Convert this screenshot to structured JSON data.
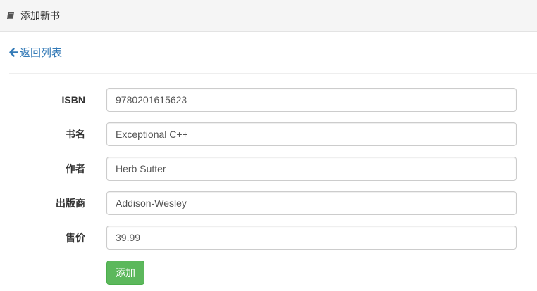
{
  "header": {
    "title": "添加新书",
    "icon": "book-icon"
  },
  "back_link": {
    "label": "返回列表",
    "icon": "arrow-left-icon",
    "color": "#337ab7"
  },
  "form": {
    "fields": [
      {
        "label": "ISBN",
        "value": "9780201615623"
      },
      {
        "label": "书名",
        "value": "Exceptional C++"
      },
      {
        "label": "作者",
        "value": "Herb Sutter"
      },
      {
        "label": "出版商",
        "value": "Addison-Wesley"
      },
      {
        "label": "售价",
        "value": "39.99"
      }
    ],
    "submit_label": "添加",
    "submit_color": "#5cb85c"
  }
}
